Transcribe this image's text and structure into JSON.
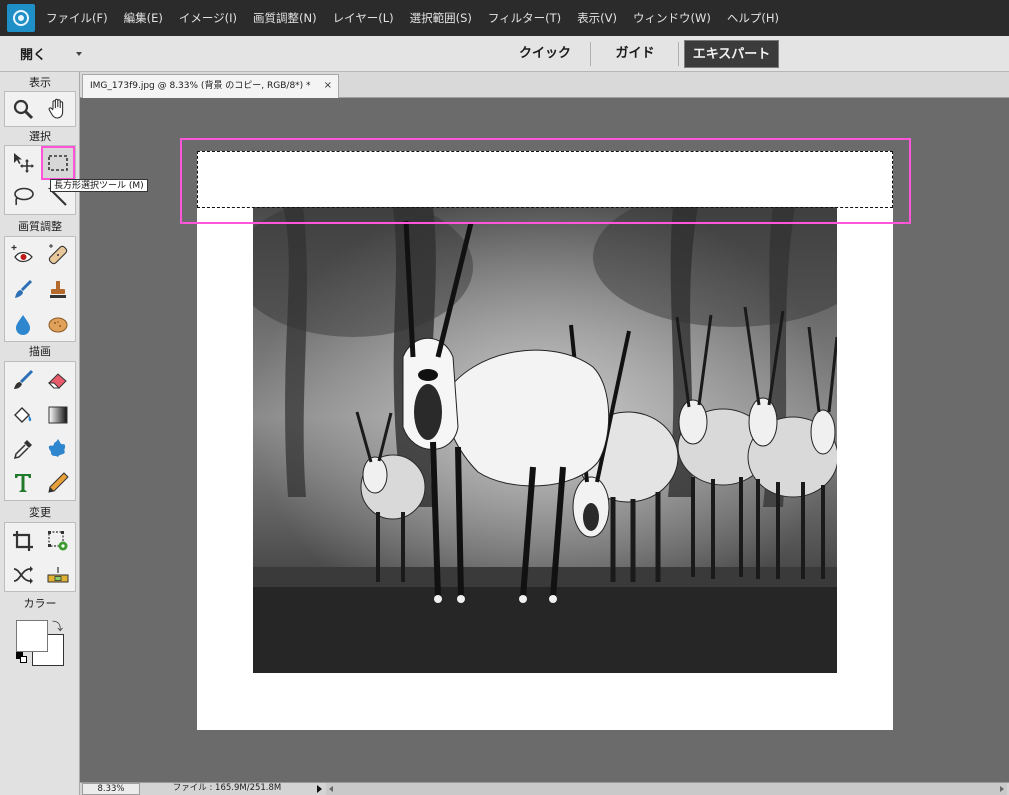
{
  "menubar": {
    "items": [
      "ファイル(F)",
      "編集(E)",
      "イメージ(I)",
      "画質調整(N)",
      "レイヤー(L)",
      "選択範囲(S)",
      "フィルター(T)",
      "表示(V)",
      "ウィンドウ(W)",
      "ヘルプ(H)"
    ]
  },
  "modebar": {
    "open_label": "開く",
    "tabs": [
      "クイック",
      "ガイド",
      "エキスパート"
    ],
    "active_tab": "エキスパート"
  },
  "toolbox": {
    "sections": {
      "view": "表示",
      "select": "選択",
      "enhance": "画質調整",
      "draw": "描画",
      "modify": "変更",
      "color": "カラー"
    },
    "selected_tool": "rectangular-marquee-tool",
    "tooltip": "長方形選択ツール (M)",
    "foreground_color": "#ffffff",
    "background_color": "#ffffff"
  },
  "document": {
    "tab_title": "IMG_173f9.jpg @ 8.33% (背景 のコピー, RGB/8*) *",
    "close_glyph": "×"
  },
  "statusbar": {
    "zoom": "8.33%",
    "file_info": "ファイル : 165.9M/251.8M"
  },
  "colors": {
    "highlight": "#ff55d9",
    "menubar_bg": "#2b2b2b",
    "canvas_bg": "#6b6b6b",
    "accent": "#1e8fc7"
  }
}
